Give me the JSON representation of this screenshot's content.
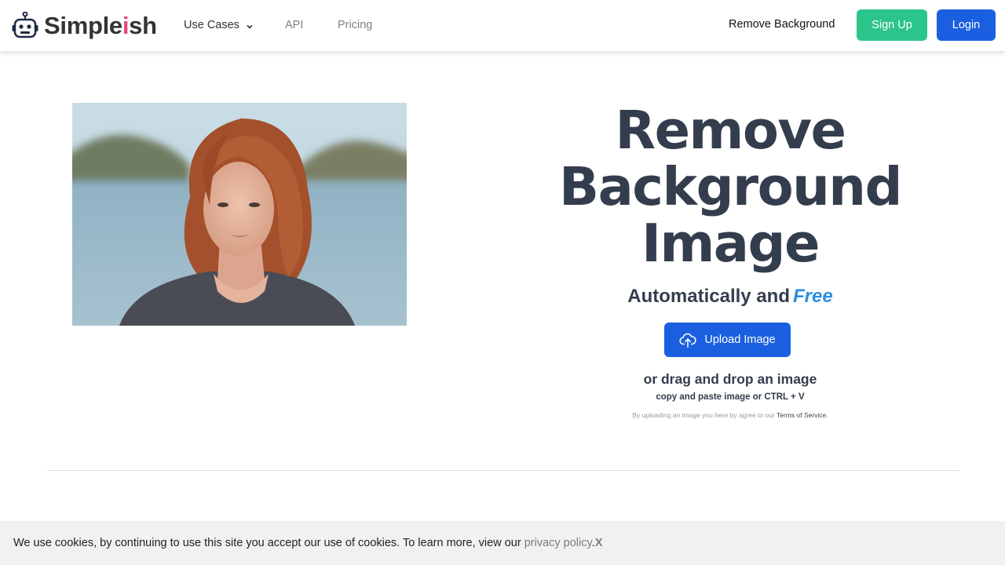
{
  "header": {
    "logo": {
      "text_main": "Simple",
      "text_accent": "i",
      "text_end": "sh",
      "icon": "robot-icon",
      "accent_color": "#e8467c"
    },
    "nav": [
      {
        "label": "Use Cases",
        "has_dropdown": true
      },
      {
        "label": "API"
      },
      {
        "label": "Pricing"
      }
    ],
    "remove_background_link": "Remove Background",
    "signup_label": "Sign Up",
    "login_label": "Login",
    "signup_color": "#2bc48b",
    "login_color": "#1a5fe0"
  },
  "hero": {
    "title": "Remove Background Image",
    "subtitle": "Automatically and",
    "subtitle_highlight": "Free",
    "upload_label": "Upload Image",
    "upload_icon": "cloud-upload-icon",
    "drag_text": "or drag and drop an image",
    "paste_text": "copy and paste image or CTRL + V",
    "terms_prefix": "By uploading an image you here by agree to our",
    "terms_link": "Terms of Service."
  },
  "cookie_bar": {
    "text": "We use cookies, by continuing to use this site you accept our use of cookies. To learn more, view our",
    "policy_link": "privacy policy",
    "period": ".",
    "close_label": "X"
  }
}
